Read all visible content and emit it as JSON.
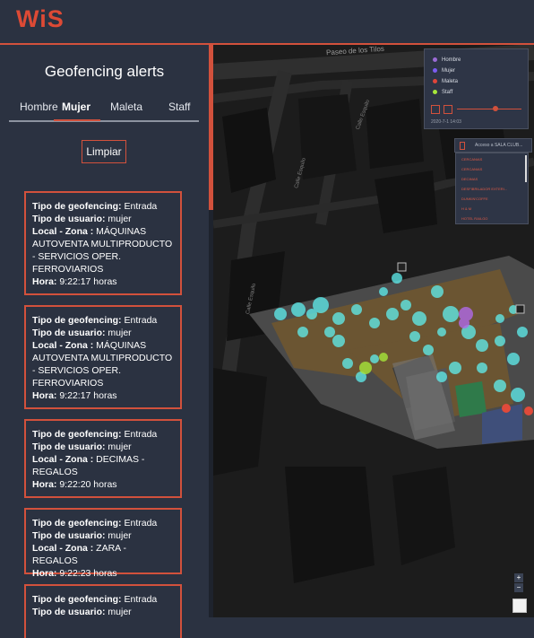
{
  "header": {
    "logo": "WiS"
  },
  "panel": {
    "title": "Geofencing alerts",
    "tabs": [
      "Hombre",
      "Mujer",
      "Maleta",
      "Staff"
    ],
    "clear_label": "Limpiar"
  },
  "alerts": [
    {
      "type_label": "Tipo de geofencing:",
      "type": "Entrada",
      "user_label": "Tipo de usuario:",
      "user": "mujer",
      "zone_label": "Local - Zona :",
      "zone": "MÁQUINAS AUTOVENTA MULTIPRODUCTO - SERVICIOS OPER. FERROVIARIOS",
      "time_label": "Hora:",
      "time": "9:22:17 horas"
    },
    {
      "type_label": "Tipo de geofencing:",
      "type": "Entrada",
      "user_label": "Tipo de usuario:",
      "user": "mujer",
      "zone_label": "Local - Zona :",
      "zone": "MÁQUINAS AUTOVENTA MULTIPRODUCTO - SERVICIOS OPER. FERROVIARIOS",
      "time_label": "Hora:",
      "time": "9:22:17 horas"
    },
    {
      "type_label": "Tipo de geofencing:",
      "type": "Entrada",
      "user_label": "Tipo de usuario:",
      "user": "mujer",
      "zone_label": "Local - Zona :",
      "zone": "DECIMAS - REGALOS",
      "time_label": "Hora:",
      "time": "9:22:20 horas"
    },
    {
      "type_label": "Tipo de geofencing:",
      "type": "Entrada",
      "user_label": "Tipo de usuario:",
      "user": "mujer",
      "zone_label": "Local - Zona :",
      "zone": "ZARA - REGALOS",
      "time_label": "Hora:",
      "time": "9:22:23 horas"
    },
    {
      "type_label": "Tipo de geofencing:",
      "type": "Entrada",
      "user_label": "Tipo de usuario:",
      "user": "mujer"
    }
  ],
  "map": {
    "streets": [
      "Paseo de los Tilos",
      "Calle Esquilo",
      "Calle Esquilo",
      "Calle Esquilo"
    ],
    "legend": [
      {
        "label": "Hombre",
        "color": "#9b6bd6"
      },
      {
        "label": "Mujer",
        "color": "#7b5cf0"
      },
      {
        "label": "Maleta",
        "color": "#e0453a"
      },
      {
        "label": "Staff",
        "color": "#a6e63a"
      }
    ],
    "date": "2020-7-1 14:03",
    "dropdown_text": "Acceso a SALA CLUB...",
    "list_items": [
      "CERCANIAS",
      "CERCANIAS",
      "DECIMAS",
      "DESFIBRILADOR EXTERI...",
      "DUNKIN'COFFE",
      "H & M",
      "HOTEL RAILGO"
    ],
    "zoom_in": "+",
    "zoom_out": "−"
  }
}
